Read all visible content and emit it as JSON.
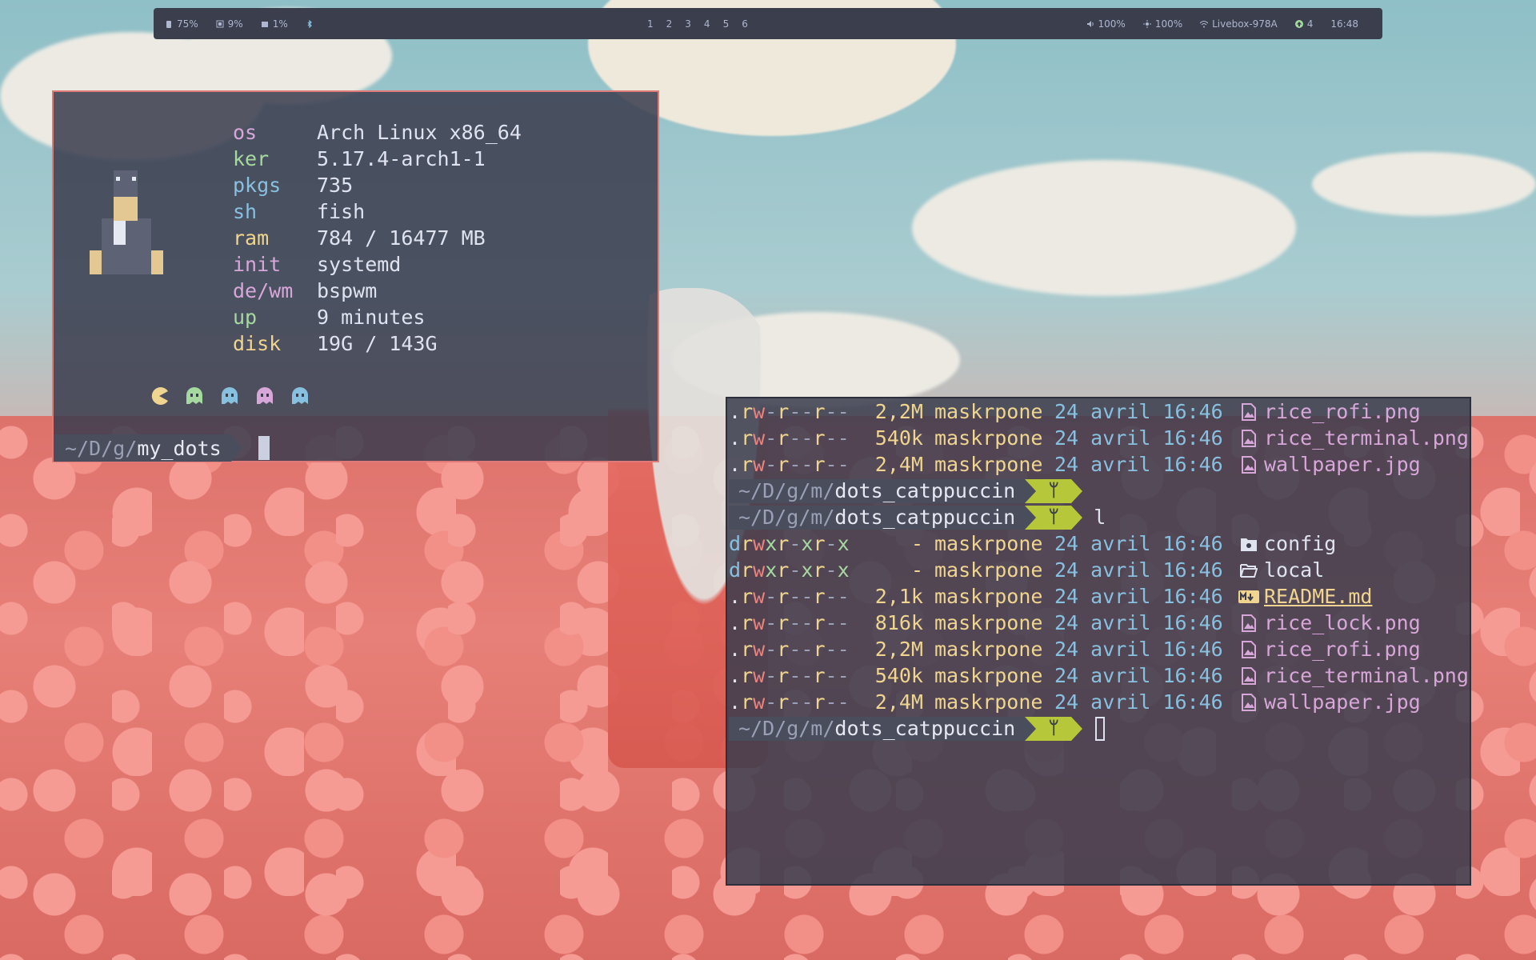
{
  "topbar": {
    "battery": "75%",
    "cpu": "9%",
    "mem": "1%",
    "workspaces": [
      "1",
      "2",
      "3",
      "4",
      "5",
      "6"
    ],
    "volume": "100%",
    "brightness": "100%",
    "wifi": "Livebox-978A",
    "updates": "4",
    "clock": "16:48"
  },
  "fetch": {
    "rows": [
      {
        "key": "os",
        "value": "Arch Linux x86_64"
      },
      {
        "key": "ker",
        "value": "5.17.4-arch1-1"
      },
      {
        "key": "pkgs",
        "value": "735"
      },
      {
        "key": "sh",
        "value": "fish"
      },
      {
        "key": "ram",
        "value": "784 / 16477 MB"
      },
      {
        "key": "init",
        "value": "systemd"
      },
      {
        "key": "de/wm",
        "value": "bspwm"
      },
      {
        "key": "up",
        "value": "9 minutes"
      },
      {
        "key": "disk",
        "value": "19G / 143G"
      }
    ],
    "prompt_prefix": "~/D/g/",
    "prompt_dir": "my_dots"
  },
  "terminal": {
    "lines_top": [
      {
        "perm": ".rw-r--r--",
        "size": "2,2M",
        "user": "maskrpone",
        "date": "24 avril 16:46",
        "name": "rice_rofi.png",
        "kind": "img"
      },
      {
        "perm": ".rw-r--r--",
        "size": "540k",
        "user": "maskrpone",
        "date": "24 avril 16:46",
        "name": "rice_terminal.png",
        "kind": "img"
      },
      {
        "perm": ".rw-r--r--",
        "size": "2,4M",
        "user": "maskrpone",
        "date": "24 avril 16:46",
        "name": "wallpaper.jpg",
        "kind": "img"
      }
    ],
    "prompt_prefix": "~/D/g/m/",
    "prompt_dir": "dots_catppuccin",
    "command": "l",
    "lines_bottom": [
      {
        "perm": "drwxr-xr-x",
        "size": "-",
        "user": "maskrpone",
        "date": "24 avril 16:46",
        "name": "config",
        "kind": "dir-config"
      },
      {
        "perm": "drwxr-xr-x",
        "size": "-",
        "user": "maskrpone",
        "date": "24 avril 16:46",
        "name": "local",
        "kind": "dir"
      },
      {
        "perm": ".rw-r--r--",
        "size": "2,1k",
        "user": "maskrpone",
        "date": "24 avril 16:46",
        "name": "README.md",
        "kind": "md"
      },
      {
        "perm": ".rw-r--r--",
        "size": "816k",
        "user": "maskrpone",
        "date": "24 avril 16:46",
        "name": "rice_lock.png",
        "kind": "img"
      },
      {
        "perm": ".rw-r--r--",
        "size": "2,2M",
        "user": "maskrpone",
        "date": "24 avril 16:46",
        "name": "rice_rofi.png",
        "kind": "img"
      },
      {
        "perm": ".rw-r--r--",
        "size": "540k",
        "user": "maskrpone",
        "date": "24 avril 16:46",
        "name": "rice_terminal.png",
        "kind": "img"
      },
      {
        "perm": ".rw-r--r--",
        "size": "2,4M",
        "user": "maskrpone",
        "date": "24 avril 16:46",
        "name": "wallpaper.jpg",
        "kind": "img"
      }
    ]
  },
  "colors": {
    "accent_pink": "#d8a7d9",
    "accent_yellow": "#efd58f",
    "accent_blue": "#88c0e0",
    "accent_green": "#a6d99f",
    "git_green": "#b7c73a",
    "border_red": "#e07a78"
  }
}
